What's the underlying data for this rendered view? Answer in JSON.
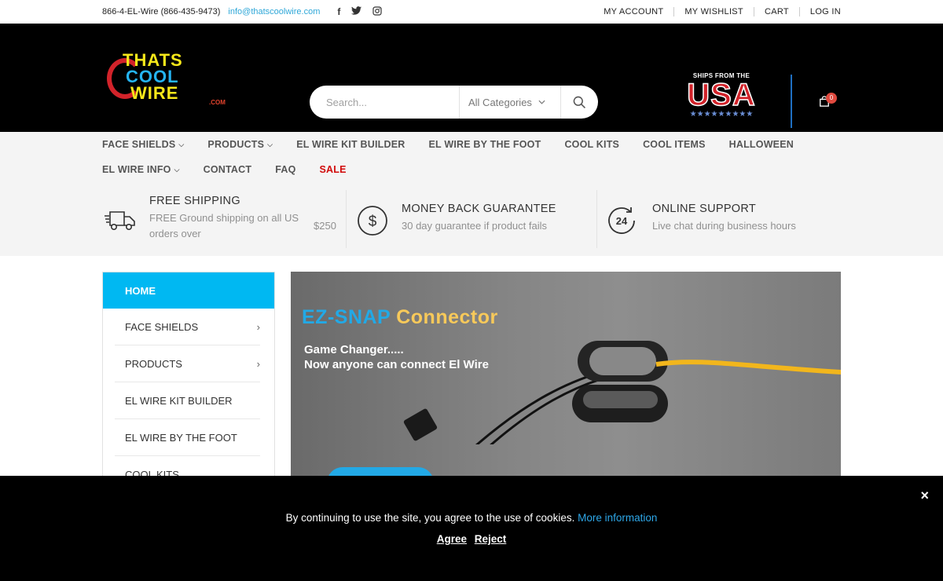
{
  "topbar": {
    "phone": "866-4-EL-Wire (866-435-9473)",
    "email": "info@thatscoolwire.com",
    "social": [
      {
        "icon": "facebook-icon",
        "glyph": "f"
      },
      {
        "icon": "twitter-icon",
        "glyph": "🐦"
      },
      {
        "icon": "instagram-icon",
        "glyph": "◎"
      }
    ],
    "links": [
      "MY ACCOUNT",
      "MY WISHLIST",
      "CART",
      "LOG IN"
    ]
  },
  "header": {
    "logo": {
      "line1": "THATS",
      "line2": "COOL",
      "line3": "WIRE",
      "suffix": ".COM"
    },
    "search": {
      "placeholder": "Search...",
      "category": "All Categories"
    },
    "usa_badge": {
      "ships": "SHIPS FROM THE",
      "word": "USA",
      "stars": "★★★★★★★★★"
    },
    "cart_count": "0"
  },
  "nav": {
    "row1": [
      {
        "label": "FACE SHIELDS",
        "dropdown": true
      },
      {
        "label": "PRODUCTS",
        "dropdown": true
      },
      {
        "label": "EL WIRE KIT BUILDER",
        "dropdown": false
      },
      {
        "label": "EL WIRE BY THE FOOT",
        "dropdown": false
      },
      {
        "label": "COOL KITS",
        "dropdown": false
      },
      {
        "label": "COOL ITEMS",
        "dropdown": false
      },
      {
        "label": "HALLOWEEN",
        "dropdown": false
      }
    ],
    "row2": [
      {
        "label": "EL WIRE INFO",
        "dropdown": true
      },
      {
        "label": "CONTACT",
        "dropdown": false
      },
      {
        "label": "FAQ",
        "dropdown": false
      },
      {
        "label": "SALE",
        "dropdown": false
      }
    ]
  },
  "features": [
    {
      "icon": "truck-icon",
      "title": "FREE SHIPPING",
      "desc_line1": "FREE Ground shipping on all US",
      "desc_line2": "orders over",
      "extra": "$250"
    },
    {
      "icon": "dollar-circle-icon",
      "title": "MONEY BACK GUARANTEE",
      "desc_line1": "30 day guarantee if product fails"
    },
    {
      "icon": "support-24-icon",
      "icon_text": "24",
      "title": "ONLINE SUPPORT",
      "desc_line1": "Live chat during business hours"
    }
  ],
  "sidebar": {
    "home": "HOME",
    "items": [
      {
        "label": "FACE SHIELDS",
        "arrow": "›"
      },
      {
        "label": "PRODUCTS",
        "arrow": "›"
      },
      {
        "label": "EL WIRE KIT BUILDER"
      },
      {
        "label": "EL WIRE BY THE FOOT"
      },
      {
        "label": "COOL KITS"
      }
    ]
  },
  "hero": {
    "title_a": "EZ-SNAP",
    "title_b": "Connector",
    "sub_line1": "Game Changer.....",
    "sub_line2": "Now anyone can connect El Wire"
  },
  "cookie": {
    "message": "By continuing to use the site, you agree to the use of cookies.",
    "more": "More information",
    "agree": "Agree",
    "reject": "Reject",
    "close": "×"
  }
}
